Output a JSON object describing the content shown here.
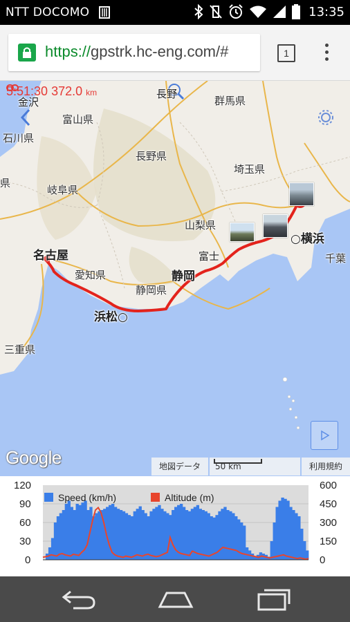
{
  "status_bar": {
    "carrier": "NTT DOCOMO",
    "time": "13:35"
  },
  "browser": {
    "url_scheme": "https://",
    "url_rest": "gpstrk.hc-eng.com/#",
    "tab_count": "1"
  },
  "map": {
    "trip_time": "5:51:30",
    "trip_distance": "372.0",
    "distance_unit": "km",
    "labels": {
      "kanazawa": "金沢",
      "ishikawa": "石川県",
      "toyama_ken": "富山県",
      "nagano_city": "長野",
      "gunma": "群馬県",
      "nagano_ken": "長野県",
      "saitama": "埼玉県",
      "gifu": "岐阜県",
      "yamanashi": "山梨県",
      "yokohama": "横浜",
      "nagoya": "名古屋",
      "aichi": "愛知県",
      "fuji": "富士",
      "shizuoka": "静岡",
      "chiba": "千葉",
      "shizuoka_ken": "静岡県",
      "hamamatsu": "浜松",
      "mie": "三重県",
      "ken_left": "県"
    },
    "google": "Google",
    "attribution_data": "地図データ",
    "scale": "50 km",
    "terms": "利用規約"
  },
  "chart_data": {
    "type": "bar",
    "series": [
      {
        "name": "Speed (km/h)",
        "chart": "bar",
        "color": "#3a7ee8",
        "axis": "left"
      },
      {
        "name": "Altitude (m)",
        "chart": "line",
        "color": "#e8452c",
        "axis": "right"
      }
    ],
    "y_left": {
      "ylim": [
        0,
        120
      ],
      "ticks": [
        "120",
        "90",
        "60",
        "30",
        "0"
      ]
    },
    "y_right": {
      "ylim": [
        0,
        600
      ],
      "ticks": [
        "600",
        "450",
        "300",
        "150",
        "0"
      ]
    },
    "speed_values": [
      0,
      10,
      20,
      35,
      60,
      70,
      75,
      80,
      90,
      95,
      85,
      80,
      90,
      88,
      92,
      95,
      80,
      85,
      70,
      75,
      78,
      80,
      82,
      85,
      88,
      90,
      85,
      82,
      80,
      78,
      75,
      72,
      70,
      78,
      82,
      86,
      80,
      75,
      70,
      78,
      82,
      85,
      88,
      82,
      78,
      75,
      72,
      80,
      85,
      88,
      90,
      85,
      80,
      78,
      82,
      85,
      88,
      82,
      80,
      78,
      75,
      70,
      68,
      72,
      78,
      82,
      85,
      80,
      78,
      75,
      70,
      65,
      60,
      55,
      20,
      15,
      10,
      5,
      8,
      12,
      10,
      8,
      5,
      30,
      60,
      85,
      95,
      100,
      98,
      95,
      85,
      80,
      75,
      70,
      50,
      30,
      15
    ],
    "altitude_values": [
      20,
      25,
      30,
      40,
      35,
      30,
      45,
      50,
      40,
      35,
      30,
      45,
      40,
      35,
      60,
      80,
      120,
      220,
      320,
      400,
      420,
      380,
      300,
      200,
      120,
      60,
      40,
      30,
      25,
      20,
      30,
      25,
      20,
      30,
      40,
      35,
      30,
      40,
      45,
      35,
      30,
      25,
      30,
      40,
      50,
      60,
      180,
      120,
      80,
      60,
      50,
      45,
      40,
      35,
      70,
      60,
      50,
      45,
      40,
      35,
      30,
      40,
      50,
      60,
      80,
      100,
      95,
      90,
      85,
      80,
      75,
      60,
      50,
      45,
      40,
      35,
      30,
      25,
      20,
      30,
      25,
      20,
      15,
      20,
      25,
      30,
      35,
      40,
      30,
      25,
      20,
      15,
      10,
      15,
      10,
      5,
      10
    ],
    "legend_placement": "top-left"
  }
}
